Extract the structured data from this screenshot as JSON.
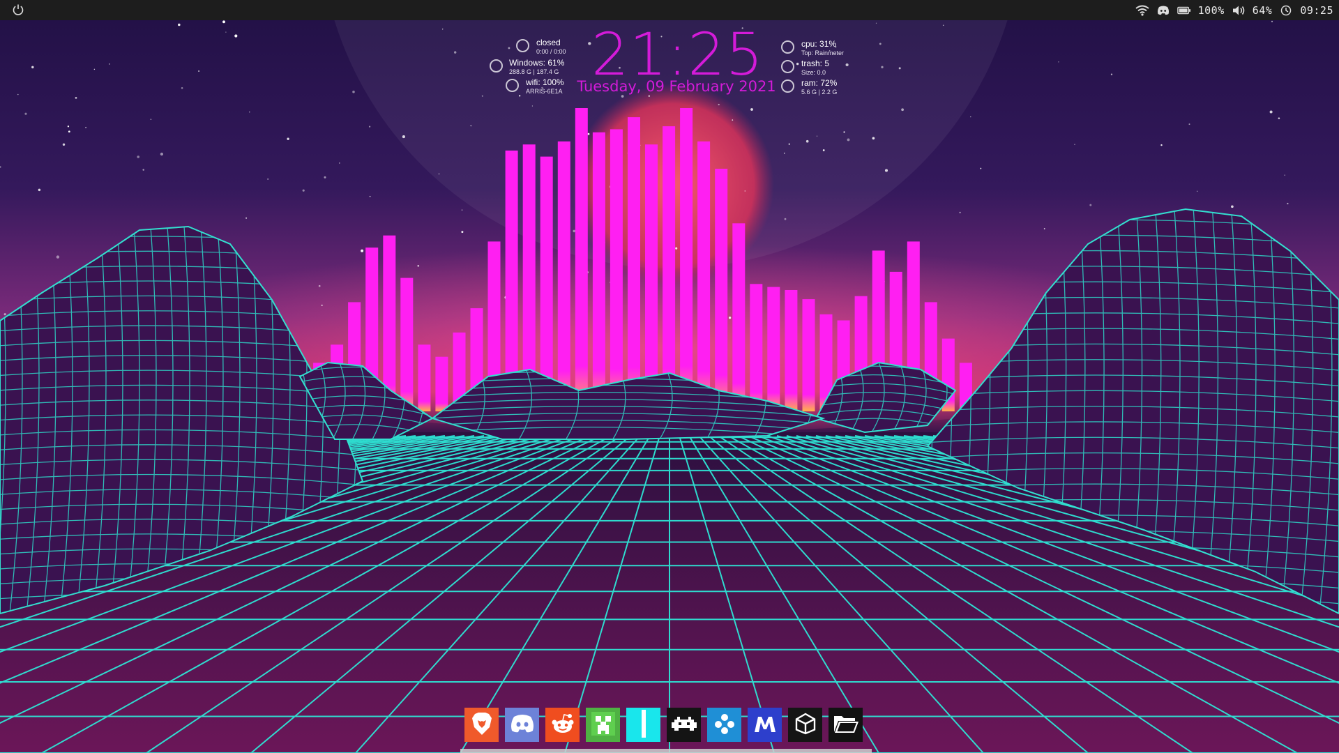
{
  "topbar": {
    "power_icon": "power-icon",
    "battery_percent": "100%",
    "volume_percent": "64%",
    "time": "09:25",
    "icons": [
      "wifi-icon",
      "discord-icon",
      "battery-icon",
      "volume-icon",
      "clock-icon"
    ]
  },
  "clock": {
    "time": "21:25",
    "date": "Tuesday, 09 February 2021",
    "color": "#d41bd9"
  },
  "stats_left": [
    {
      "label": "closed",
      "detail": "0:00 / 0:00"
    },
    {
      "label": "Windows: 61%",
      "detail": "288.8 G | 187.4 G"
    },
    {
      "label": "wifi: 100%",
      "detail": "ARRIS-6E1A"
    }
  ],
  "stats_right": [
    {
      "label": "cpu: 31%",
      "detail": "Top: Rainmeter"
    },
    {
      "label": "trash: 5",
      "detail": "Size: 0.0"
    },
    {
      "label": "ram: 72%",
      "detail": "5.6 G | 2.2 G"
    }
  ],
  "visualizer": {
    "color": "#ff1ff2",
    "levels": [
      0.1,
      0.16,
      0.22,
      0.36,
      0.54,
      0.58,
      0.44,
      0.22,
      0.18,
      0.26,
      0.34,
      0.56,
      0.86,
      0.88,
      0.84,
      0.89,
      1.0,
      0.92,
      0.93,
      0.97,
      0.88,
      0.94,
      1.0,
      0.89,
      0.8,
      0.62,
      0.42,
      0.41,
      0.4,
      0.37,
      0.32,
      0.3,
      0.38,
      0.53,
      0.46,
      0.56,
      0.36,
      0.24,
      0.16
    ]
  },
  "dock": {
    "apps": [
      {
        "name": "brave",
        "icon": "brave-lion-icon",
        "bg": "#f05a2b"
      },
      {
        "name": "discord",
        "icon": "discord-icon",
        "bg": "#6d82d8"
      },
      {
        "name": "reddit",
        "icon": "reddit-icon",
        "bg": "#f04d1f"
      },
      {
        "name": "minecraft",
        "icon": "creeper-icon",
        "bg": "#4fb143"
      },
      {
        "name": "cyan-app",
        "icon": "vertical-bar-icon",
        "bg": "#19e6ec"
      },
      {
        "name": "retroarch",
        "icon": "space-invader-icon",
        "bg": "#141414"
      },
      {
        "name": "ppsspp",
        "icon": "gamepad-icon",
        "bg": "#1f8fd6"
      },
      {
        "name": "malwarebytes",
        "icon": "m-logo-icon",
        "bg": "#2d3fcc"
      },
      {
        "name": "unity",
        "icon": "unity-icon",
        "bg": "#151515"
      },
      {
        "name": "files",
        "icon": "folder-open-icon",
        "bg": "#121212"
      }
    ]
  }
}
